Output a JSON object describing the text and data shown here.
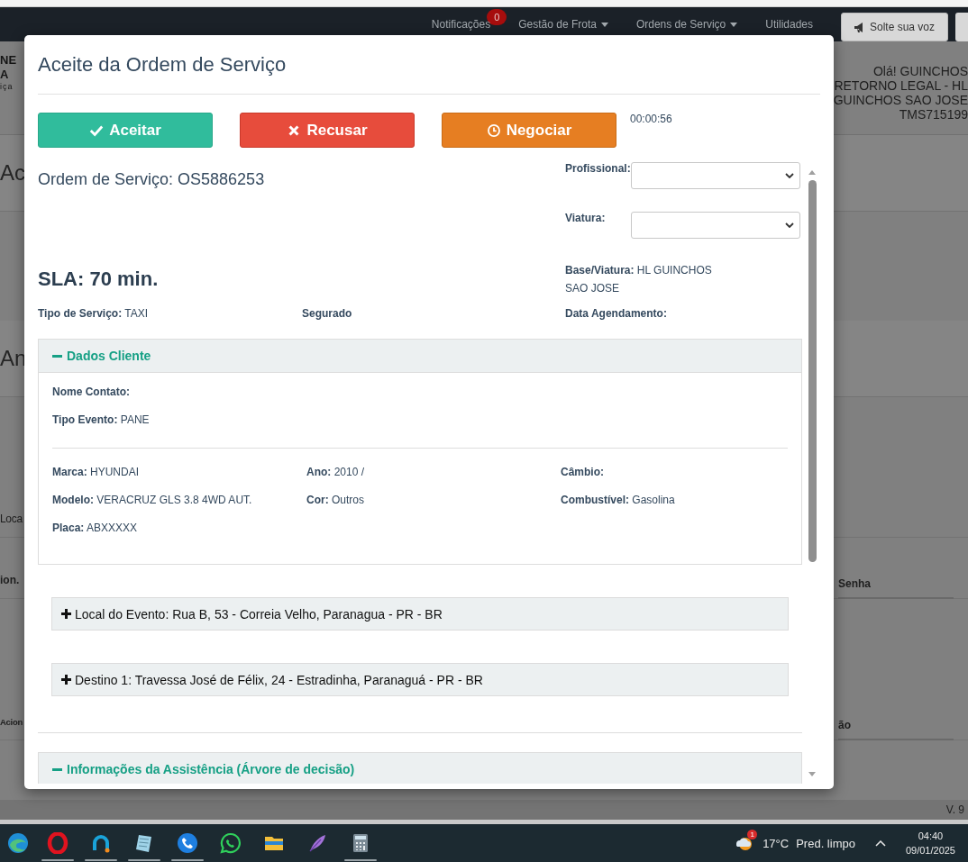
{
  "navbar": {
    "items": [
      {
        "label": "Notificações",
        "kind": "badge",
        "badge": "0"
      },
      {
        "label": "Gestão de Frota",
        "kind": "dropdown"
      },
      {
        "label": "Ordens de Serviço",
        "kind": "dropdown"
      },
      {
        "label": "Utilidades",
        "kind": "plain"
      }
    ],
    "feedback_button": "Solte sua voz"
  },
  "page": {
    "logo": [
      "NE",
      "A",
      "iça"
    ],
    "greeting": [
      "Olá! GUINCHOS",
      "RETORNO LEGAL - HL",
      "GUINCHOS SAO JOSE",
      "TMS715199"
    ],
    "rows": [
      {
        "kind": "heading",
        "left": "Ac"
      },
      {
        "kind": "heading",
        "left": "An"
      },
      {
        "kind": "label",
        "left": "Loca"
      },
      {
        "kind": "column",
        "left": "ion.",
        "right": "Senha"
      },
      {
        "kind": "column",
        "left": "Acion",
        "right": "ão"
      }
    ],
    "version": "V. 9"
  },
  "modal": {
    "title": "Aceite da Ordem de Serviço",
    "actions": [
      {
        "label": "Aceitar",
        "kind": "accept"
      },
      {
        "label": "Recusar",
        "kind": "reject"
      },
      {
        "label": "Negociar",
        "kind": "negotiate"
      }
    ],
    "timer": "00:00:56",
    "order": "Ordem de Serviço: OS5886253",
    "assign_fields": [
      {
        "label": "Profissional:"
      },
      {
        "label": "Viatura:"
      }
    ],
    "sla": "SLA: 70 min.",
    "base": {
      "label": "Base/Viatura:",
      "value": "HL GUINCHOS SAO JOSE"
    },
    "summary": [
      {
        "label": "Tipo de Serviço:",
        "value": "TAXI"
      },
      {
        "label": "Segurado"
      },
      {
        "label": "Data Agendamento:"
      }
    ],
    "client_panel": {
      "title": "Dados Cliente",
      "expanded": true,
      "contact": [
        {
          "label": "Nome Contato:"
        },
        {
          "label": "Tipo Evento:",
          "value": "PANE"
        }
      ],
      "vehicle": [
        {
          "label": "Marca:",
          "value": "HYUNDAI"
        },
        {
          "label": "Ano:",
          "value": "2010 /"
        },
        {
          "label": "Câmbio:"
        },
        {
          "label": "Modelo:",
          "value": "VERACRUZ GLS 3.8 4WD AUT."
        },
        {
          "label": "Cor:",
          "value": "Outros"
        },
        {
          "label": "Combustível:",
          "value": "Gasolina"
        },
        {
          "label": "Placa:",
          "value": "ABXXXXX"
        }
      ]
    },
    "locations": [
      {
        "title": "Local do Evento: Rua B, 53 - Correia Velho, Paranagua - PR - BR",
        "expanded": false
      },
      {
        "title": "Destino 1: Travessa José de Félix, 24 - Estradinha, Paranaguá - PR - BR",
        "expanded": false
      }
    ],
    "assistance_panel": {
      "title": "Informações da Assistência (Árvore de decisão)",
      "expanded": true
    }
  },
  "taskbar": {
    "apps": [
      {
        "kind": "wave",
        "running": false
      },
      {
        "kind": "ring",
        "running": true
      },
      {
        "kind": "arc",
        "running": true
      },
      {
        "kind": "notepad",
        "running": true
      },
      {
        "kind": "phone",
        "running": true
      },
      {
        "kind": "chat",
        "running": false
      },
      {
        "kind": "folder",
        "running": false
      },
      {
        "kind": "feather",
        "running": false
      },
      {
        "kind": "calculator",
        "running": true
      }
    ],
    "weather": {
      "badge": "1",
      "temperature": "17°C",
      "condition": "Pred. limpo"
    },
    "time": "04:40",
    "date": "09/01/2025"
  }
}
